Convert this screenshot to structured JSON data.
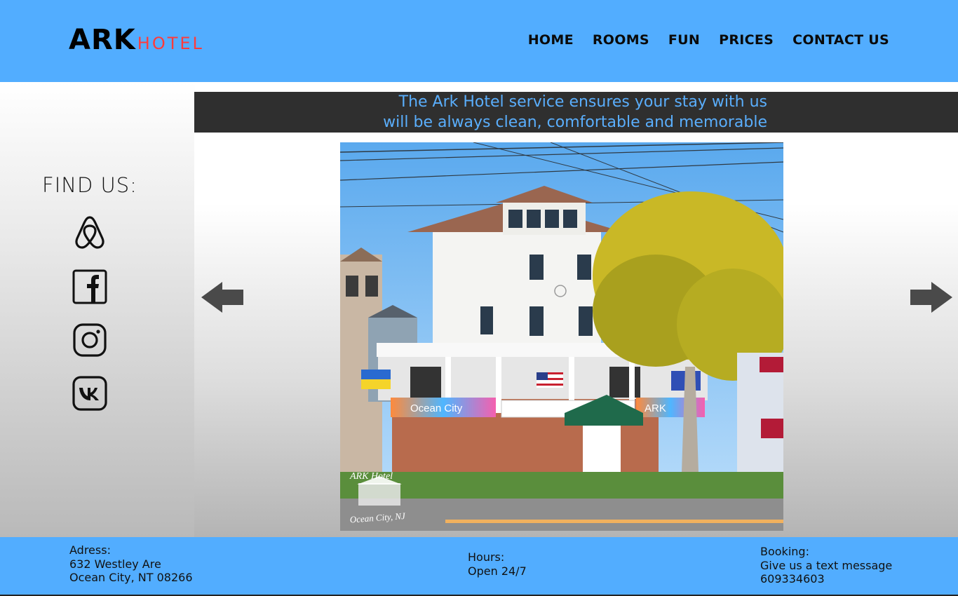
{
  "logo": {
    "primary": "ARK",
    "secondary": "HOTEL"
  },
  "nav": {
    "items": [
      "HOME",
      "ROOMS",
      "FUN",
      "PRICES",
      "CONTACT US"
    ]
  },
  "sidebar": {
    "heading": "FIND US:",
    "icons": [
      "airbnb-icon",
      "facebook-icon",
      "instagram-icon",
      "vk-icon"
    ]
  },
  "banner": {
    "line1": "The Ark Hotel service ensures your stay with us",
    "line2": "will be always clean, comfortable and memorable"
  },
  "photo": {
    "watermark_line1": "ARK   Hotel",
    "watermark_line2": "Ocean City, NJ",
    "sign_left": "Ocean City",
    "sign_right": "ARK"
  },
  "carousel": {
    "prev_icon": "arrow-left-icon",
    "next_icon": "arrow-right-icon"
  },
  "footer": {
    "address": {
      "label": "Adress:",
      "line1": "632 Westley Are",
      "line2": "Ocean City, NT 08266"
    },
    "hours": {
      "label": "Hours:",
      "line1": "Open 24/7"
    },
    "booking": {
      "label": "Booking:",
      "line1": "Give us  a text message",
      "line2": "609334603"
    }
  },
  "colors": {
    "header_bg": "#52adff",
    "banner_bg": "#2f2f2f",
    "banner_text": "#5aaefc",
    "logo_accent": "#ff3b3b"
  }
}
